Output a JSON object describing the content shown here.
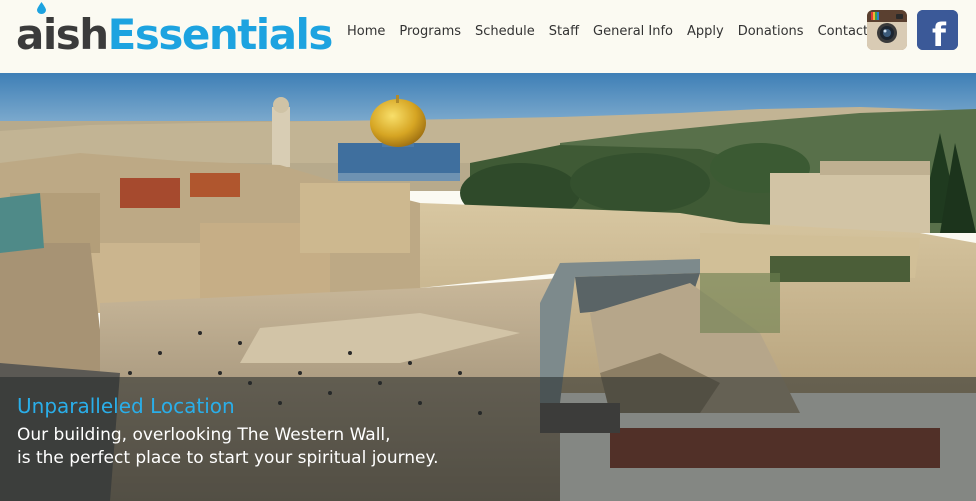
{
  "logo": {
    "part1": "aish",
    "part2": "Essentials"
  },
  "nav": {
    "items": [
      {
        "label": "Home"
      },
      {
        "label": "Programs"
      },
      {
        "label": "Schedule"
      },
      {
        "label": "Staff"
      },
      {
        "label": "General Info"
      },
      {
        "label": "Apply"
      },
      {
        "label": "Donations"
      },
      {
        "label": "Contact Us"
      }
    ]
  },
  "social": {
    "instagram_icon": "instagram-icon",
    "facebook_icon": "facebook-icon",
    "facebook_glyph": "f"
  },
  "hero": {
    "image": "western-wall-jerusalem-panorama",
    "title": "Unparalleled Location",
    "line1": "Our building, overlooking The Western Wall,",
    "line2": "is the perfect place to start your spiritual journey."
  },
  "colors": {
    "accent": "#1da3e0",
    "caption_title": "#2aaee9",
    "header_bg": "#fbfaf2",
    "facebook": "#3b5998"
  }
}
